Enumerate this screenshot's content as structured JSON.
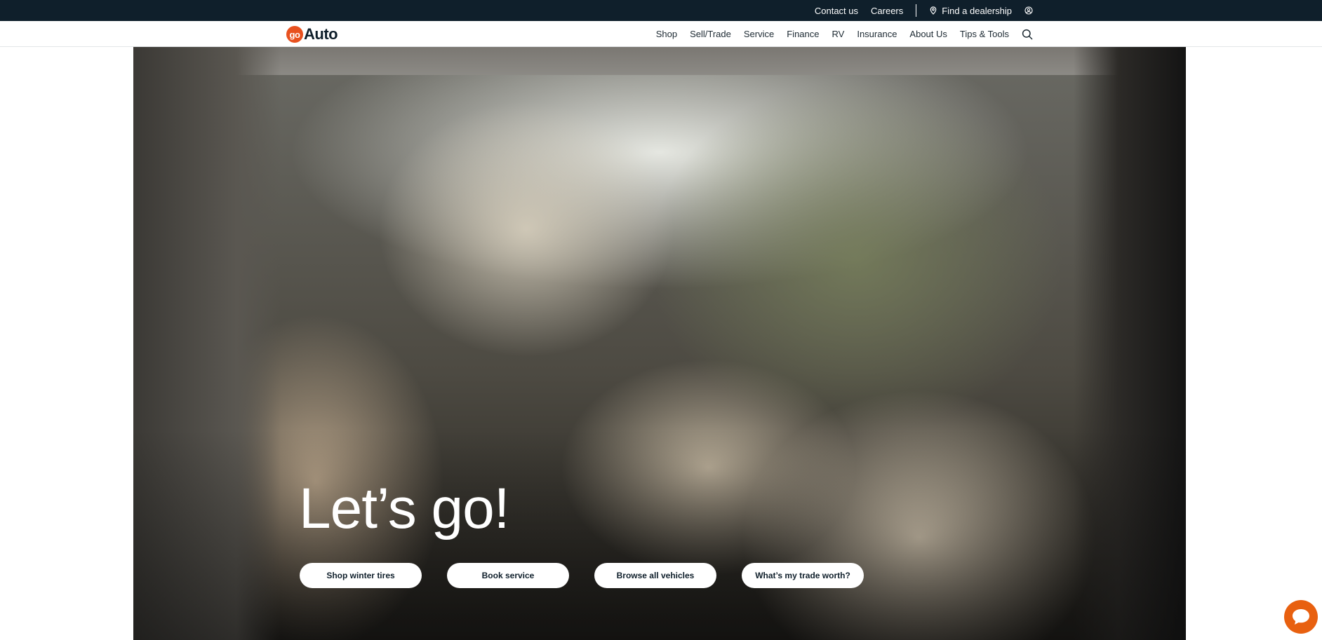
{
  "utility": {
    "contact": "Contact us",
    "careers": "Careers",
    "dealership": "Find a dealership",
    "pin_icon": "location-pin-icon",
    "user_icon": "account-icon"
  },
  "brand": {
    "badge": "go",
    "word": "Auto",
    "accent": "#e8511f",
    "dark": "#0f1f2b"
  },
  "nav": {
    "items": [
      "Shop",
      "Sell/Trade",
      "Service",
      "Finance",
      "RV",
      "Insurance",
      "About Us",
      "Tips & Tools"
    ],
    "search_icon": "search-icon"
  },
  "hero": {
    "title": "Let’s go!",
    "image_description_alt": "",
    "ctas": [
      "Shop winter tires",
      "Book service",
      "Browse all vehicles",
      "What’s my trade worth?"
    ]
  },
  "chat": {
    "icon": "chat-icon",
    "color": "#e8600f"
  }
}
